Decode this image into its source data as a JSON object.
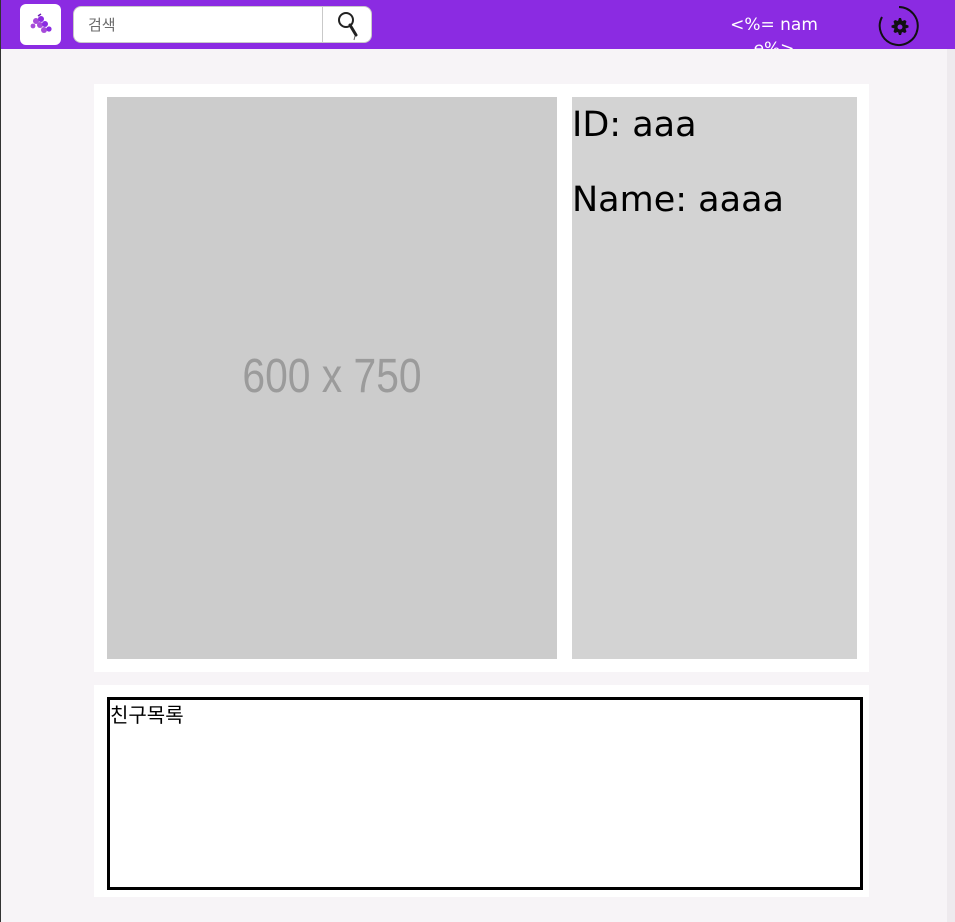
{
  "navbar": {
    "logo_icon": "grape-logo-icon",
    "search": {
      "placeholder": "검색",
      "value": "",
      "button_icon": "search-icon"
    },
    "username": "<%= name%>",
    "settings_icon": "gear-icon",
    "colors": {
      "bar": "#8b2be2"
    }
  },
  "profile": {
    "image_placeholder": "600 x 750",
    "id_line": "ID: aaa",
    "name_line": "Name: aaaa"
  },
  "friends": {
    "title": "친구목록"
  }
}
